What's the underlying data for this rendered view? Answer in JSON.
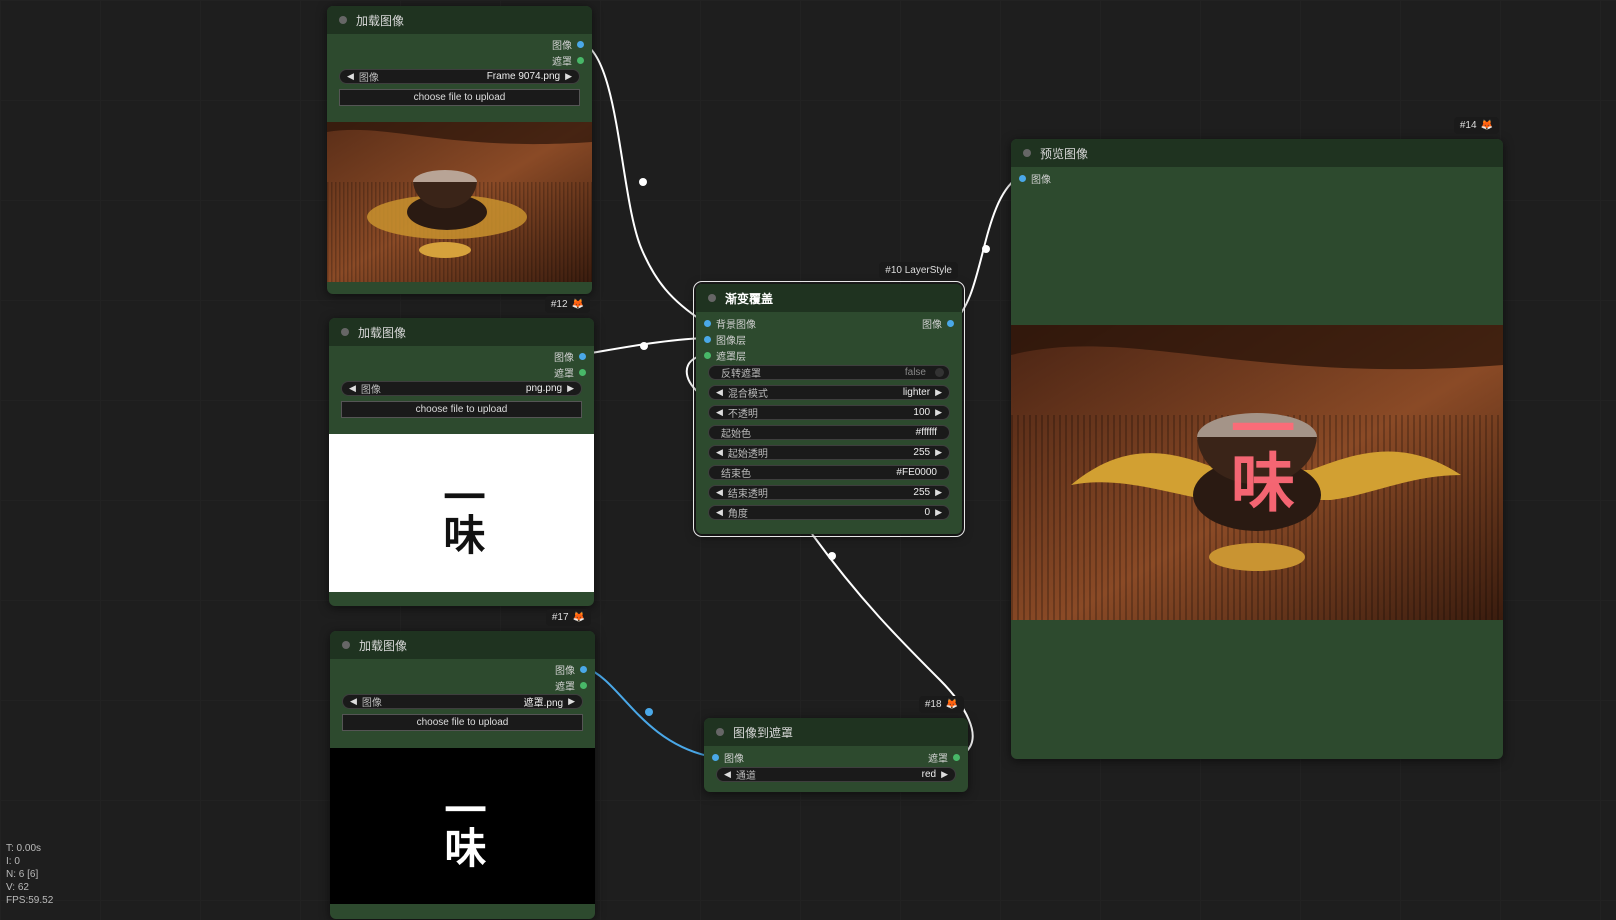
{
  "nodes": {
    "load1": {
      "id": "",
      "title": "加载图像",
      "out_image": "图像",
      "out_mask": "遮罩",
      "widget_label": "图像",
      "widget_value": "Frame 9074.png",
      "upload": "choose file to upload"
    },
    "load2": {
      "id": "#12",
      "title": "加载图像",
      "out_image": "图像",
      "out_mask": "遮罩",
      "widget_label": "图像",
      "widget_value": "png.png",
      "upload": "choose file to upload",
      "preview_text": "一味"
    },
    "load3": {
      "id": "#17",
      "title": "加载图像",
      "out_image": "图像",
      "out_mask": "遮罩",
      "widget_label": "图像",
      "widget_value": "遮罩.png",
      "upload": "choose file to upload",
      "preview_text": "一味"
    },
    "gradient": {
      "id": "#10 LayerStyle",
      "title": "渐变覆盖",
      "in_bg": "背景图像",
      "in_layer": "图像层",
      "in_mask": "遮罩层",
      "out_image": "图像",
      "widgets": [
        {
          "label": "反转遮罩",
          "value": "false",
          "kind": "toggle"
        },
        {
          "label": "混合模式",
          "value": "lighter",
          "kind": "combo"
        },
        {
          "label": "不透明",
          "value": "100",
          "kind": "number"
        },
        {
          "label": "起始色",
          "value": "#ffffff",
          "kind": "text"
        },
        {
          "label": "起始透明",
          "value": "255",
          "kind": "number"
        },
        {
          "label": "结束色",
          "value": "#FE0000",
          "kind": "text"
        },
        {
          "label": "结束透明",
          "value": "255",
          "kind": "number"
        },
        {
          "label": "角度",
          "value": "0",
          "kind": "number"
        }
      ]
    },
    "img2mask": {
      "id": "#18",
      "title": "图像到遮罩",
      "in_image": "图像",
      "out_mask": "遮罩",
      "widget_label": "通道",
      "widget_value": "red"
    },
    "preview": {
      "id": "#14",
      "title": "预览图像",
      "in_image": "图像",
      "overlay_text": "一味"
    }
  },
  "stats": {
    "t": "T: 0.00s",
    "i": "I: 0",
    "n": "N: 6 [6]",
    "v": "V: 62",
    "fps": "FPS:59.52"
  },
  "colors": {
    "node_bg": "#2d4a2e",
    "node_header": "#1f3320",
    "link_white": "#ffffff",
    "link_blue": "#4aa8e8",
    "end_color": "#FE0000"
  },
  "icons": [
    "fox-icon",
    "left-arrow-icon",
    "right-arrow-icon"
  ]
}
